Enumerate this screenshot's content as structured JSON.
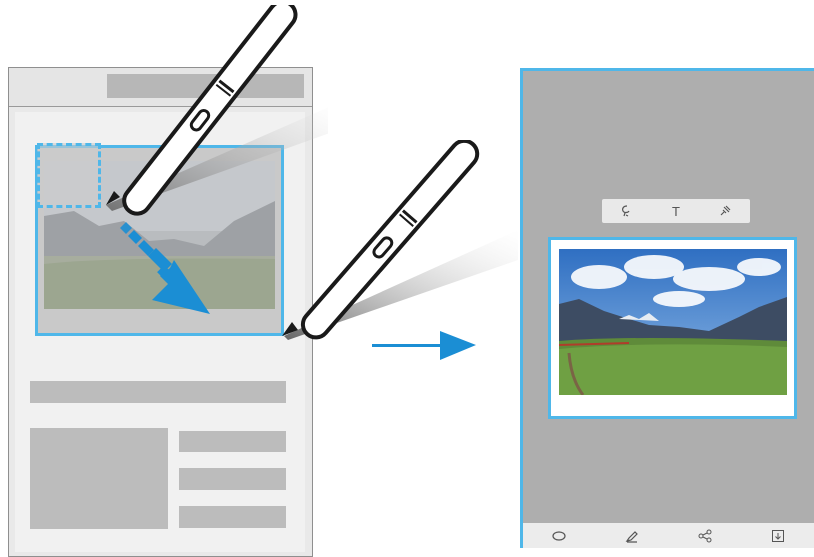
{
  "left_screen": {
    "title_placeholder": "",
    "selection_color": "#4fb7e9"
  },
  "arrow_color": "#1b8ed4",
  "capture_toolbar": {
    "icons": [
      "lasso-draw-icon",
      "text-icon",
      "pin-icon"
    ],
    "text_glyph": "T"
  },
  "bottom_toolbar": {
    "icons": [
      "shape-icon",
      "pen-icon",
      "share-icon",
      "save-icon"
    ]
  }
}
